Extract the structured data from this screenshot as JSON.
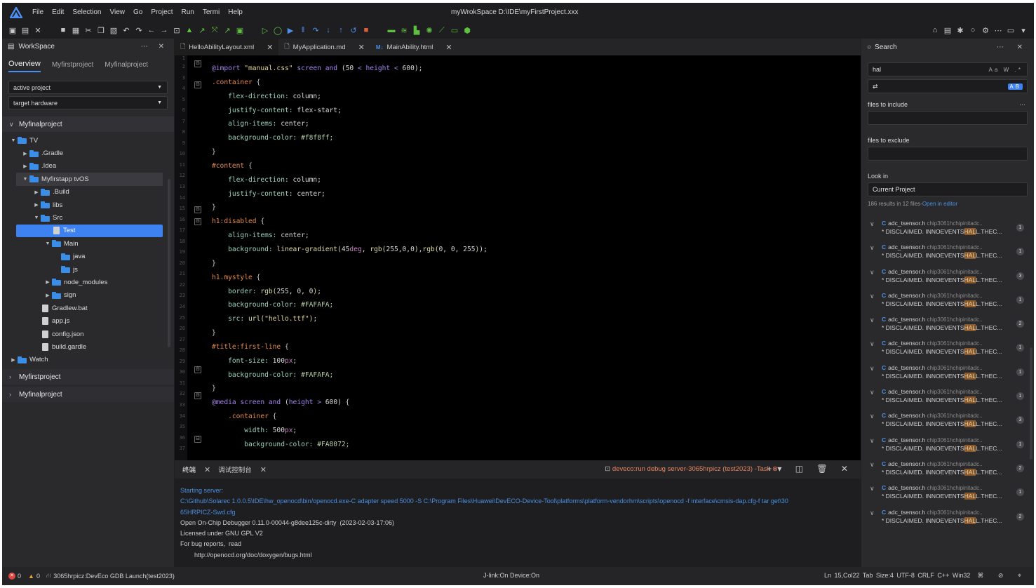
{
  "menubar": {
    "items": [
      "File",
      "Edit",
      "Selection",
      "View",
      "Go",
      "Project",
      "Run",
      "Termi",
      "Help"
    ],
    "title": "myWrokSpace  D:\\IDE\\myFirstProject.xxx"
  },
  "workspace": {
    "title": "WorkSpace",
    "tabs": [
      "Overview",
      "Myfirstproject",
      "Myfinalproject"
    ],
    "active_project_label": "active project",
    "target_hardware_label": "target hardware",
    "project_expanded": "Myfinalproject",
    "tree": [
      {
        "label": "TV",
        "type": "folder",
        "depth": 0,
        "expanded": true
      },
      {
        "label": ".Gradle",
        "type": "folder",
        "depth": 1,
        "expanded": false
      },
      {
        "label": ".Idea",
        "type": "folder",
        "depth": 1,
        "expanded": false
      },
      {
        "label": "Myfirstapp tvOS",
        "type": "folder",
        "depth": 1,
        "expanded": true
      },
      {
        "label": ".Build",
        "type": "folder",
        "depth": 2,
        "expanded": false
      },
      {
        "label": "libs",
        "type": "folder",
        "depth": 2,
        "expanded": false
      },
      {
        "label": "Src",
        "type": "folder",
        "depth": 2,
        "expanded": true
      },
      {
        "label": "Test",
        "type": "file",
        "depth": 3,
        "selected": true
      },
      {
        "label": "Main",
        "type": "folder",
        "depth": 3,
        "expanded": true
      },
      {
        "label": "java",
        "type": "folder",
        "depth": 4
      },
      {
        "label": "js",
        "type": "folder",
        "depth": 4
      },
      {
        "label": "node_modules",
        "type": "folder",
        "depth": 3,
        "expanded": false
      },
      {
        "label": "sign",
        "type": "folder",
        "depth": 3,
        "expanded": false
      },
      {
        "label": "Gradlew.bat",
        "type": "file",
        "depth": 2
      },
      {
        "label": "app.js",
        "type": "file",
        "depth": 2
      },
      {
        "label": "config.json",
        "type": "file",
        "depth": 2
      },
      {
        "label": "build.gardle",
        "type": "file",
        "depth": 2
      },
      {
        "label": "Watch",
        "type": "folder",
        "depth": 0,
        "expanded": false
      }
    ],
    "collapsed_projects": [
      "Myfirstproject",
      "Myfinalproject"
    ]
  },
  "editor": {
    "tabs": [
      {
        "label": "HelloAbilityLayout.xml",
        "active": true
      },
      {
        "label": "MyApplication.md",
        "active": false
      },
      {
        "label": "MainAbility.html",
        "active": false
      }
    ],
    "line_numbers": [
      "1",
      "2",
      "3",
      "4",
      "5",
      "6",
      "7",
      "8",
      "9",
      "10",
      "11",
      "12",
      "13",
      "14",
      "15",
      "16",
      "17",
      "18",
      "19",
      "20",
      "21",
      "22",
      "23",
      "24",
      "25",
      "26",
      "27",
      "28",
      "29",
      "30",
      "31",
      "32",
      "33",
      "34",
      "35",
      "36",
      "37"
    ]
  },
  "terminal": {
    "tabs": [
      "终端",
      "调试控制台"
    ],
    "task": "deveco:run debug server-3065hrpicz (test2023) -Task",
    "lines": [
      {
        "text": "Starting server:",
        "color": "blue"
      },
      {
        "text": "C:\\Github\\Solarec 1.0.0.5\\IDE\\hw_openocd\\bin/openocd.exe-C adapter speed 5000 -S C:\\Program Files\\Huawei\\DevECO-Device-Tool\\platforms\\platform-vendorhm\\scripts\\openocd -f interface\\cmsis-dap.cfg-f tar get\\30",
        "color": "blue"
      },
      {
        "text": "65HRPICZ-Swd.cfg",
        "color": "blue"
      },
      {
        "text": "Open On-Chip Debugger 0.11.0-00044-g8dee125c-dirty  (2023-02-03-17:06)",
        "color": "normal"
      },
      {
        "text": "Licensed under GNU GPL V2",
        "color": "normal"
      },
      {
        "text": "For bug reports,  read",
        "color": "normal"
      },
      {
        "text": "        http://openocd.org/doc/doxygen/bugs.html",
        "color": "normal"
      }
    ]
  },
  "search": {
    "title": "Search",
    "query": "hal",
    "replace": "",
    "files_include_label": "files to include",
    "files_exclude_label": "files to exclude",
    "look_in_label": "Look in",
    "look_in_value": "Current Project",
    "summary": "186 results in 12 files-",
    "open_in_editor": "Open in editor",
    "results": [
      {
        "file": "adc_tsensor.h",
        "path": "chip3061hchipinitadc..",
        "pre": "* DISCLAIMED. INNOEVENTS",
        "match": "HAL",
        "post": "L.THEC...",
        "count": "1"
      },
      {
        "file": "adc_tsensor.h",
        "path": "chip3061hchipinitadc..",
        "pre": "* DISCLAIMED. INNOEVENTS",
        "match": "HAL",
        "post": "L.THEC...",
        "count": "1"
      },
      {
        "file": "adc_tsensor.h",
        "path": "chip3061hchipinitadc..",
        "pre": "* DISCLAIMED. INNOEVENTS",
        "match": "HAL",
        "post": "L.THEC...",
        "count": "3"
      },
      {
        "file": "adc_tsensor.h",
        "path": "chip3061hchipinitadc..",
        "pre": "* DISCLAIMED. INNOEVENTS",
        "match": "HAL",
        "post": "L.THEC...",
        "count": "1"
      },
      {
        "file": "adc_tsensor.h",
        "path": "chip3061hchipinitadc..",
        "pre": "* DISCLAIMED. INNOEVENTS",
        "match": "HAL",
        "post": "L.THEC...",
        "count": "2"
      },
      {
        "file": "adc_tsensor.h",
        "path": "chip3061hchipinitadc..",
        "pre": "* DISCLAIMED. INNOEVENTS",
        "match": "HAL",
        "post": "L.THEC...",
        "count": "1"
      },
      {
        "file": "adc_tsensor.h",
        "path": "chip3061hchipinitadc..",
        "pre": "* DISCLAIMED. INNOEVENTS",
        "match": "HAL",
        "post": "L.THEC...",
        "count": "1"
      },
      {
        "file": "adc_tsensor.h",
        "path": "chip3061hchipinitadc..",
        "pre": "* DISCLAIMED. INNOEVENTS",
        "match": "HAL",
        "post": "L.THEC...",
        "count": "1"
      },
      {
        "file": "adc_tsensor.h",
        "path": "chip3061hchipinitadc..",
        "pre": "* DISCLAIMED. INNOEVENTS",
        "match": "HAL",
        "post": "L.THEC...",
        "count": "3"
      },
      {
        "file": "adc_tsensor.h",
        "path": "chip3061hchipinitadc..",
        "pre": "* DISCLAIMED. INNOEVENTS",
        "match": "HAL",
        "post": "L.THEC...",
        "count": "1"
      },
      {
        "file": "adc_tsensor.h",
        "path": "chip3061hchipinitadc..",
        "pre": "* DISCLAIMED. INNOEVENTS",
        "match": "HAL",
        "post": "L.THEC...",
        "count": "2"
      },
      {
        "file": "adc_tsensor.h",
        "path": "chip3061hchipinitadc..",
        "pre": "* DISCLAIMED. INNOEVENTS",
        "match": "HAL",
        "post": "L.THEC...",
        "count": "1"
      },
      {
        "file": "adc_tsensor.h",
        "path": "chip3061hchipinitadc..",
        "pre": "* DISCLAIMED. INNOEVENTS",
        "match": "HAL",
        "post": "L.THEC...",
        "count": "2"
      }
    ]
  },
  "status": {
    "errors": "0",
    "warnings": "0",
    "launch": "3065hrpicz:DevEco GDB Launch(test2023)",
    "jlink": "J-link:On   Device:On",
    "right": "Ln 15,Col22   Tab Size:4   UTF-8   CRLF   C++   Win32"
  },
  "colors": {
    "accent": "#3d82f0",
    "task": "#e9825c",
    "link": "#4a90e2",
    "error": "#e0443e",
    "warning": "#e5a23a"
  }
}
